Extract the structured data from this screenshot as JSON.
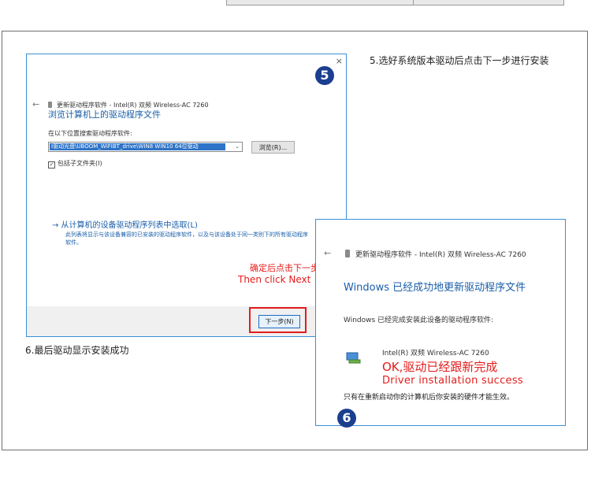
{
  "step5": {
    "instruction": "5.选好系统版本驱动后点击下一步进行安装",
    "badge": "5",
    "dialog": {
      "close_glyph": "×",
      "back_glyph": "←",
      "header": "更新驱动程序软件 - Intel(R) 双频 Wireless-AC 7260",
      "title": "浏览计算机上的驱动程序文件",
      "search_label": "在以下位置搜索驱动程序软件:",
      "path_value": "I驱动光盘\\UBOOM_WIFIBT_drive\\WIN8 WIN10 64位驱动",
      "browse_button": "浏览(R)...",
      "include_subfolders": "包括子文件夹(I)",
      "pick_link": "→ 从计算机的设备驱动程序列表中选取(L)",
      "pick_desc": "此列表将显示与该设备兼容的已安装的驱动程序软件，以及与该设备处于同一类别下的所有驱动程序软件。",
      "next_button": "下一步(N)"
    },
    "callout_cn": "确定后点击下一步",
    "callout_en": "Then click Next"
  },
  "step6": {
    "instruction": "6.最后驱动显示安装成功",
    "badge": "6",
    "dialog": {
      "back_glyph": "←",
      "header": "更新驱动程序软件 - Intel(R) 双频 Wireless-AC 7260",
      "title": "Windows 已经成功地更新驱动程序文件",
      "subtitle": "Windows 已经完成安装此设备的驱动程序软件:",
      "device": "Intel(R) 双频 Wireless-AC 7260",
      "note": "只有在重新启动你的计算机后你安装的硬件才能生效。"
    },
    "success_cn": "OK,驱动已经跟新完成",
    "success_en": "Driver installation success"
  },
  "colors": {
    "accent_blue": "#1a5ea8",
    "callout_red": "#e41c1c",
    "badge_navy": "#1b3f8f"
  }
}
